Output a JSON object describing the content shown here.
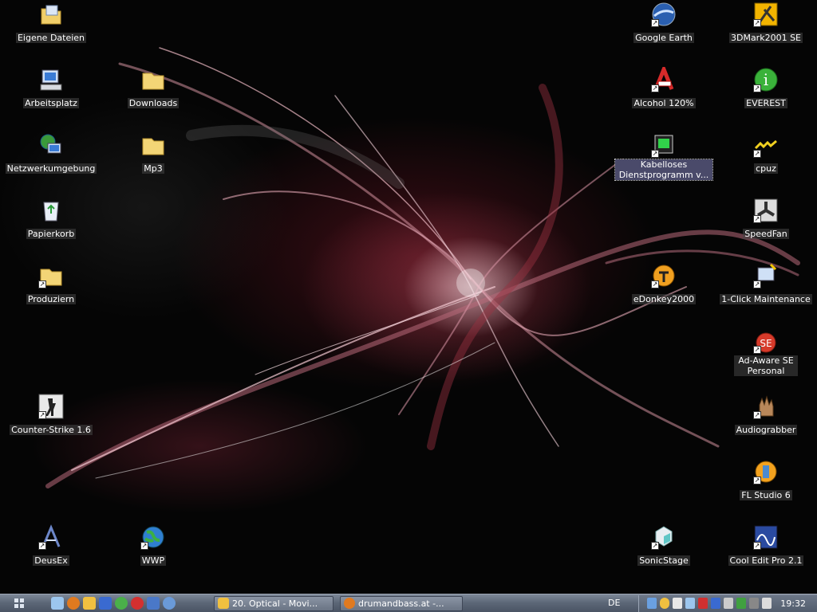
{
  "desktop": {
    "icons": {
      "eigene_dateien": "Eigene Dateien",
      "arbeitsplatz": "Arbeitsplatz",
      "netzwerkumgebung": "Netzwerkumgebung",
      "papierkorb": "Papierkorb",
      "produziern": "Produziern",
      "counter_strike": "Counter-Strike 1.6",
      "deusex": "DeusEx",
      "downloads": "Downloads",
      "mp3": "Mp3",
      "wwp": "WWP",
      "google_earth": "Google Earth",
      "alcohol": "Alcohol 120%",
      "kabelloses": "Kabelloses Dienstprogramm v...",
      "edonkey": "eDonkey2000",
      "sonicstage": "SonicStage",
      "3dmark": "3DMark2001 SE",
      "everest": "EVEREST",
      "cpuz": "cpuz",
      "speedfan": "SpeedFan",
      "oneclick": "1-Click Maintenance",
      "adaware": "Ad-Aware SE Personal",
      "audiograbber": "Audiograbber",
      "flstudio": "FL Studio 6",
      "cooledit": "Cool Edit Pro 2.1"
    }
  },
  "taskbar": {
    "tasks": [
      "20. Optical - Movi...",
      "drumandbass.at -..."
    ],
    "language": "DE",
    "clock": "19:32"
  },
  "colors": {
    "taskbar": "#5d6878",
    "label_bg": "#464646",
    "selected_label_bg": "#4a4a6a"
  }
}
